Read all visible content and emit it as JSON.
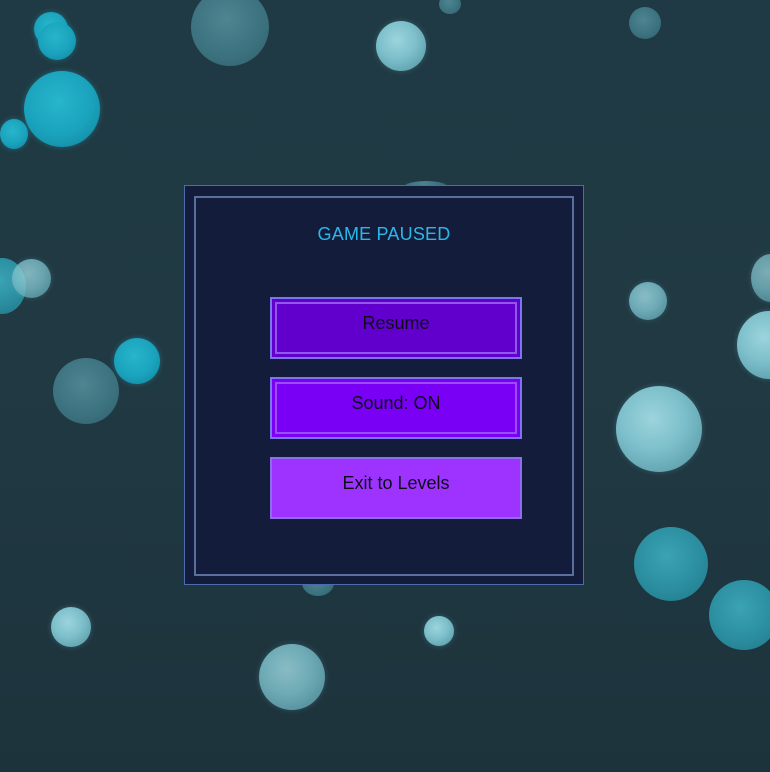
{
  "pause_menu": {
    "title": "GAME PAUSED",
    "buttons": {
      "resume": "Resume",
      "sound": "Sound: ON",
      "exit": "Exit to Levels"
    }
  },
  "colors": {
    "title": "#2ab8e8",
    "panel_background": "#141c3b",
    "resume_button": "#6100cc",
    "sound_button": "#7a00f5",
    "exit_button": "#9e33ff"
  }
}
